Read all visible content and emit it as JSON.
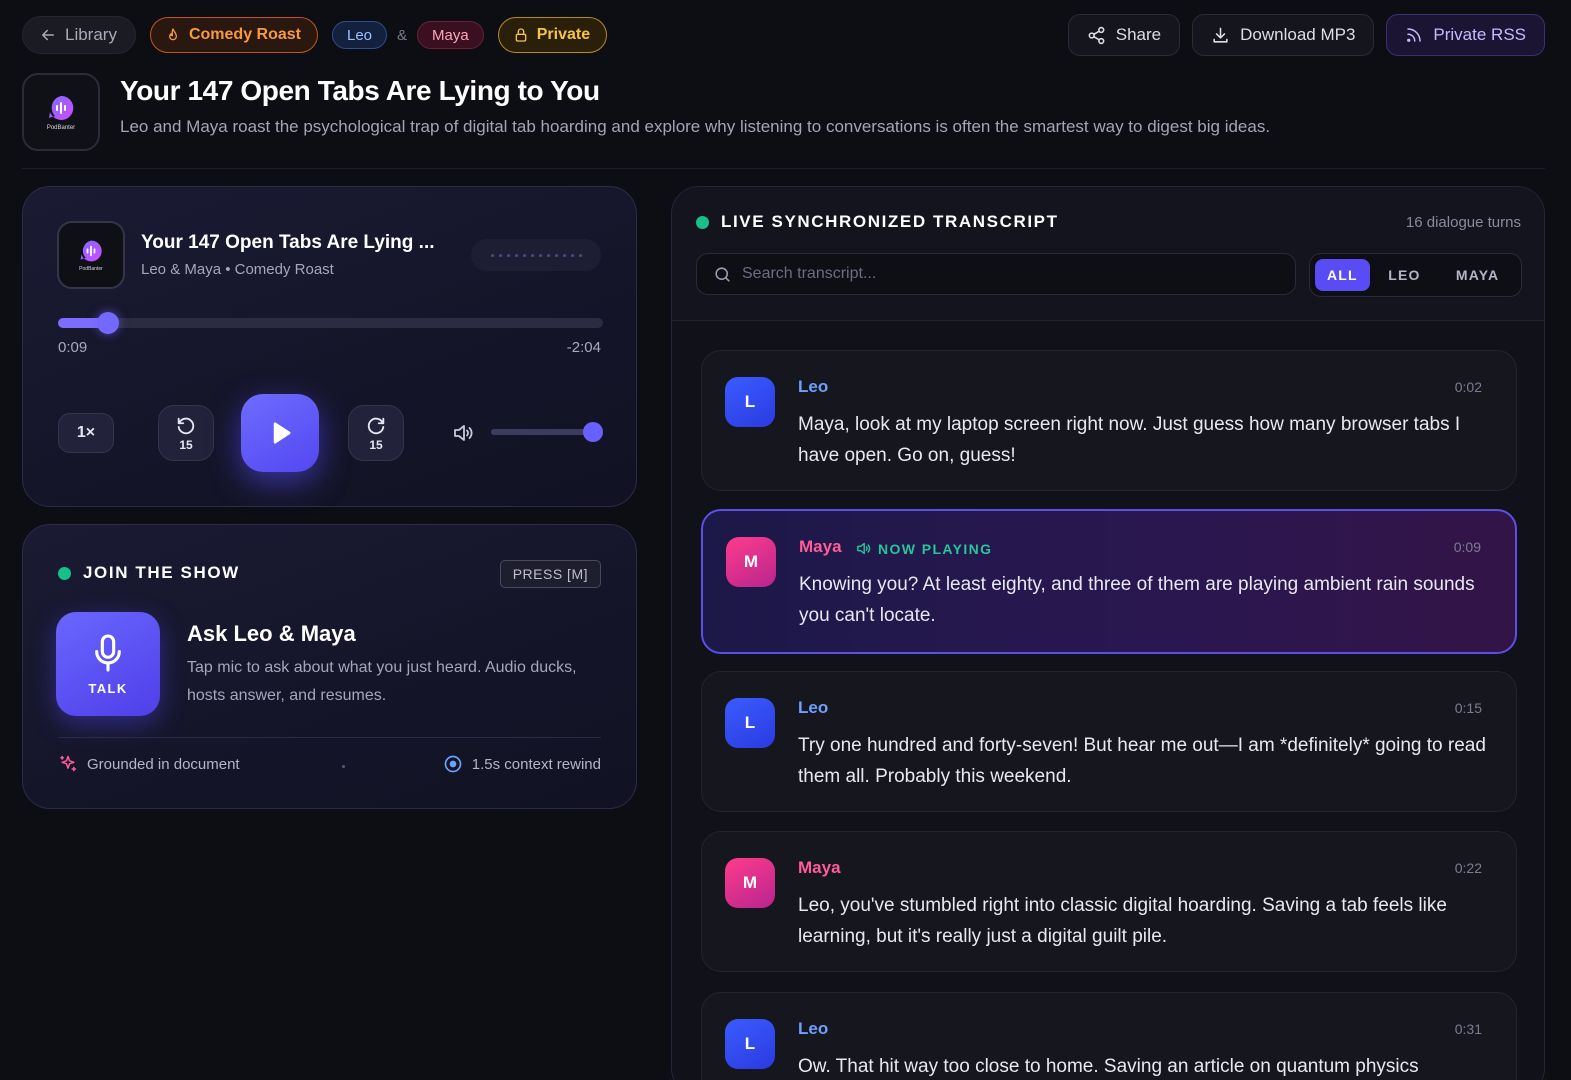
{
  "topbar": {
    "library": "Library",
    "category": "Comedy Roast",
    "host1": "Leo",
    "amp": "&",
    "host2": "Maya",
    "privacy": "Private",
    "share": "Share",
    "download": "Download MP3",
    "rss": "Private RSS"
  },
  "header": {
    "logo_text": "PodBanter",
    "title": "Your 147 Open Tabs Are Lying to You",
    "subtitle": "Leo and Maya roast the psychological trap of digital tab hoarding and explore why listening to conversations is often the smartest way to digest big ideas."
  },
  "player": {
    "logo_text": "PodBanter",
    "title": "Your 147 Open Tabs Are Lying ...",
    "meta": "Leo & Maya • Comedy Roast",
    "progress": 0.07,
    "time_current": "0:09",
    "time_remaining": "-2:04",
    "speed": "1×",
    "skip_back": "15",
    "skip_forward": "15",
    "volume": 1.0
  },
  "join": {
    "heading": "JOIN THE SHOW",
    "shortcut": "PRESS [M]",
    "talk_label": "TALK",
    "title": "Ask Leo & Maya",
    "description": "Tap mic to ask about what you just heard. Audio ducks, hosts answer, and resumes.",
    "grounded": "Grounded in document",
    "dot": "·",
    "rewind": "1.5s context rewind"
  },
  "transcript": {
    "heading": "LIVE SYNCHRONIZED TRANSCRIPT",
    "count": "16 dialogue turns",
    "search_placeholder": "Search transcript...",
    "filters": {
      "all": "ALL",
      "leo": "LEO",
      "maya": "MAYA"
    },
    "now_playing": "NOW PLAYING",
    "turns": [
      {
        "initial": "L",
        "speaker": "Leo",
        "time": "0:02",
        "text": "Maya, look at my laptop screen right now. Just guess how many browser tabs I have open. Go on, guess!"
      },
      {
        "initial": "M",
        "speaker": "Maya",
        "time": "0:09",
        "text": "Knowing you? At least eighty, and three of them are playing ambient rain sounds you can't locate."
      },
      {
        "initial": "L",
        "speaker": "Leo",
        "time": "0:15",
        "text": "Try one hundred and forty-seven! But hear me out—I am *definitely* going to read them all. Probably this weekend."
      },
      {
        "initial": "M",
        "speaker": "Maya",
        "time": "0:22",
        "text": "Leo, you've stumbled right into classic digital hoarding. Saving a tab feels like learning, but it's really just a digital guilt pile."
      },
      {
        "initial": "L",
        "speaker": "Leo",
        "time": "0:31",
        "text": "Ow. That hit way too close to home. Saving an article on quantum physics"
      }
    ]
  },
  "colors": {
    "accent": "#5a4cf5",
    "leo": "#6ea0ff",
    "maya": "#ff5c98",
    "live": "#17c08a",
    "comedy": "#f59a3f",
    "private": "#f7c24a"
  }
}
